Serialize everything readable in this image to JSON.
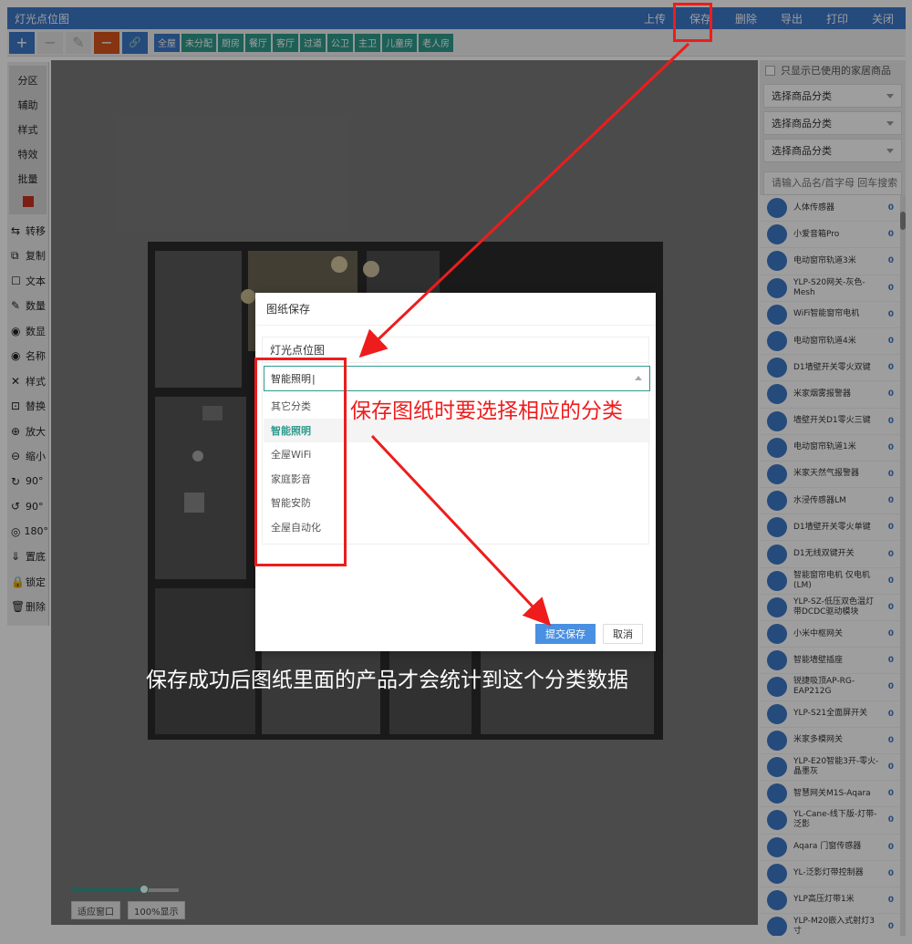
{
  "app": {
    "title": "灯光点位图",
    "menu": [
      "上传",
      "保存",
      "删除",
      "导出",
      "打印",
      "关闭"
    ]
  },
  "toolbar": {
    "buttons": [
      {
        "icon": "plus-icon",
        "glyph": "+"
      },
      {
        "icon": "minus-icon",
        "glyph": "−"
      },
      {
        "icon": "pencil-icon",
        "glyph": "✎"
      },
      {
        "icon": "minus-icon",
        "glyph": "−"
      },
      {
        "icon": "link-icon",
        "glyph": "🔗"
      }
    ],
    "rooms": [
      "全屋",
      "未分配",
      "厨房",
      "餐厅",
      "客厅",
      "过道",
      "公卫",
      "主卫",
      "儿童房",
      "老人房"
    ]
  },
  "left_tools": {
    "group": [
      "分区",
      "辅助",
      "样式",
      "特效",
      "批量"
    ],
    "actions": [
      {
        "label": "转移",
        "icon": "transfer-icon",
        "glyph": "⇆"
      },
      {
        "label": "复制",
        "icon": "copy-icon",
        "glyph": "⧉"
      },
      {
        "label": "文本",
        "icon": "text-icon",
        "glyph": "☐"
      },
      {
        "label": "数量",
        "icon": "edit-icon",
        "glyph": "✎"
      },
      {
        "label": "数显",
        "icon": "eye-icon",
        "glyph": "◉"
      },
      {
        "label": "名称",
        "icon": "eye-icon",
        "glyph": "◉"
      },
      {
        "label": "样式",
        "icon": "tools-icon",
        "glyph": "✕"
      },
      {
        "label": "替换",
        "icon": "replace-icon",
        "glyph": "⊡"
      },
      {
        "label": "放大",
        "icon": "zoom-in-icon",
        "glyph": "⊕"
      },
      {
        "label": "缩小",
        "icon": "zoom-out-icon",
        "glyph": "⊖"
      },
      {
        "label": "90°",
        "icon": "rotate-cw-icon",
        "glyph": "↻"
      },
      {
        "label": "90°",
        "icon": "rotate-ccw-icon",
        "glyph": "↺"
      },
      {
        "label": "180°",
        "icon": "rotate-180-icon",
        "glyph": "◎"
      },
      {
        "label": "置底",
        "icon": "send-back-icon",
        "glyph": "⇓"
      },
      {
        "label": "锁定",
        "icon": "lock-icon",
        "glyph": "🔒"
      },
      {
        "label": "删除",
        "icon": "trash-icon",
        "glyph": "🗑"
      }
    ]
  },
  "canvas": {
    "zoom_fit": "适应窗口",
    "zoom_100": "100%显示",
    "zoom_level": 0.68
  },
  "right_panel": {
    "only_used_label": "只显示已使用的家居商品",
    "selects": [
      "选择商品分类",
      "选择商品分类",
      "选择商品分类"
    ],
    "search_placeholder": "请输入品名/首字母 回车搜索",
    "products": [
      {
        "name": "人体传感器",
        "count": "0"
      },
      {
        "name": "小爱音箱Pro",
        "count": "0"
      },
      {
        "name": "电动窗帘轨道3米",
        "count": "0"
      },
      {
        "name": "YLP-S20网关-灰色-Mesh",
        "count": "0"
      },
      {
        "name": "WiFi智能窗帘电机",
        "count": "0"
      },
      {
        "name": "电动窗帘轨道4米",
        "count": "0"
      },
      {
        "name": "D1墙壁开关零火双键",
        "count": "0"
      },
      {
        "name": "米家烟雾报警器",
        "count": "0"
      },
      {
        "name": "墙壁开关D1零火三键",
        "count": "0"
      },
      {
        "name": "电动窗帘轨道1米",
        "count": "0"
      },
      {
        "name": "米家天然气报警器",
        "count": "0"
      },
      {
        "name": "水浸传感器LM",
        "count": "0"
      },
      {
        "name": "D1墙壁开关零火单键",
        "count": "0"
      },
      {
        "name": "D1无线双键开关",
        "count": "0"
      },
      {
        "name": "智能窗帘电机 仅电机(LM)",
        "count": "0"
      },
      {
        "name": "YLP-SZ-低压双色温灯带DCDC驱动模块",
        "count": "0"
      },
      {
        "name": "小米中枢网关",
        "count": "0"
      },
      {
        "name": "智能墙壁插座",
        "count": "0"
      },
      {
        "name": "锐捷吸顶AP-RG-EAP212G",
        "count": "0"
      },
      {
        "name": "YLP-S21全面屏开关",
        "count": "0"
      },
      {
        "name": "米家多模网关",
        "count": "0"
      },
      {
        "name": "YLP-E20智能3开-零火-晶墨灰",
        "count": "0"
      },
      {
        "name": "智慧网关M1S-Aqara",
        "count": "0"
      },
      {
        "name": "YL-Cane-线下版-灯带-泛影",
        "count": "0"
      },
      {
        "name": "Aqara 门窗传感器",
        "count": "0"
      },
      {
        "name": "YL-泛影灯带控制器",
        "count": "0"
      },
      {
        "name": "YLP高压灯带1米",
        "count": "0"
      },
      {
        "name": "YLP-M20嵌入式射灯3寸",
        "count": "0"
      }
    ]
  },
  "modal": {
    "title": "图纸保存",
    "drawing_name": "灯光点位图",
    "category_value": "智能照明",
    "options": [
      "其它分类",
      "智能照明",
      "全屋WiFi",
      "家庭影音",
      "智能安防",
      "全屋自动化"
    ],
    "selected_index": 1,
    "submit": "提交保存",
    "cancel": "取消"
  },
  "annotations": {
    "red_note": "保存图纸时要选择相应的分类",
    "white_note": "保存成功后图纸里面的产品才会统计到这个分类数据"
  },
  "colors": {
    "primary": "#3c78c8",
    "teal": "#2e9b8d",
    "orange": "#d9541e",
    "annotation_red": "#ee1c1c",
    "submit_blue": "#4a90e2"
  }
}
